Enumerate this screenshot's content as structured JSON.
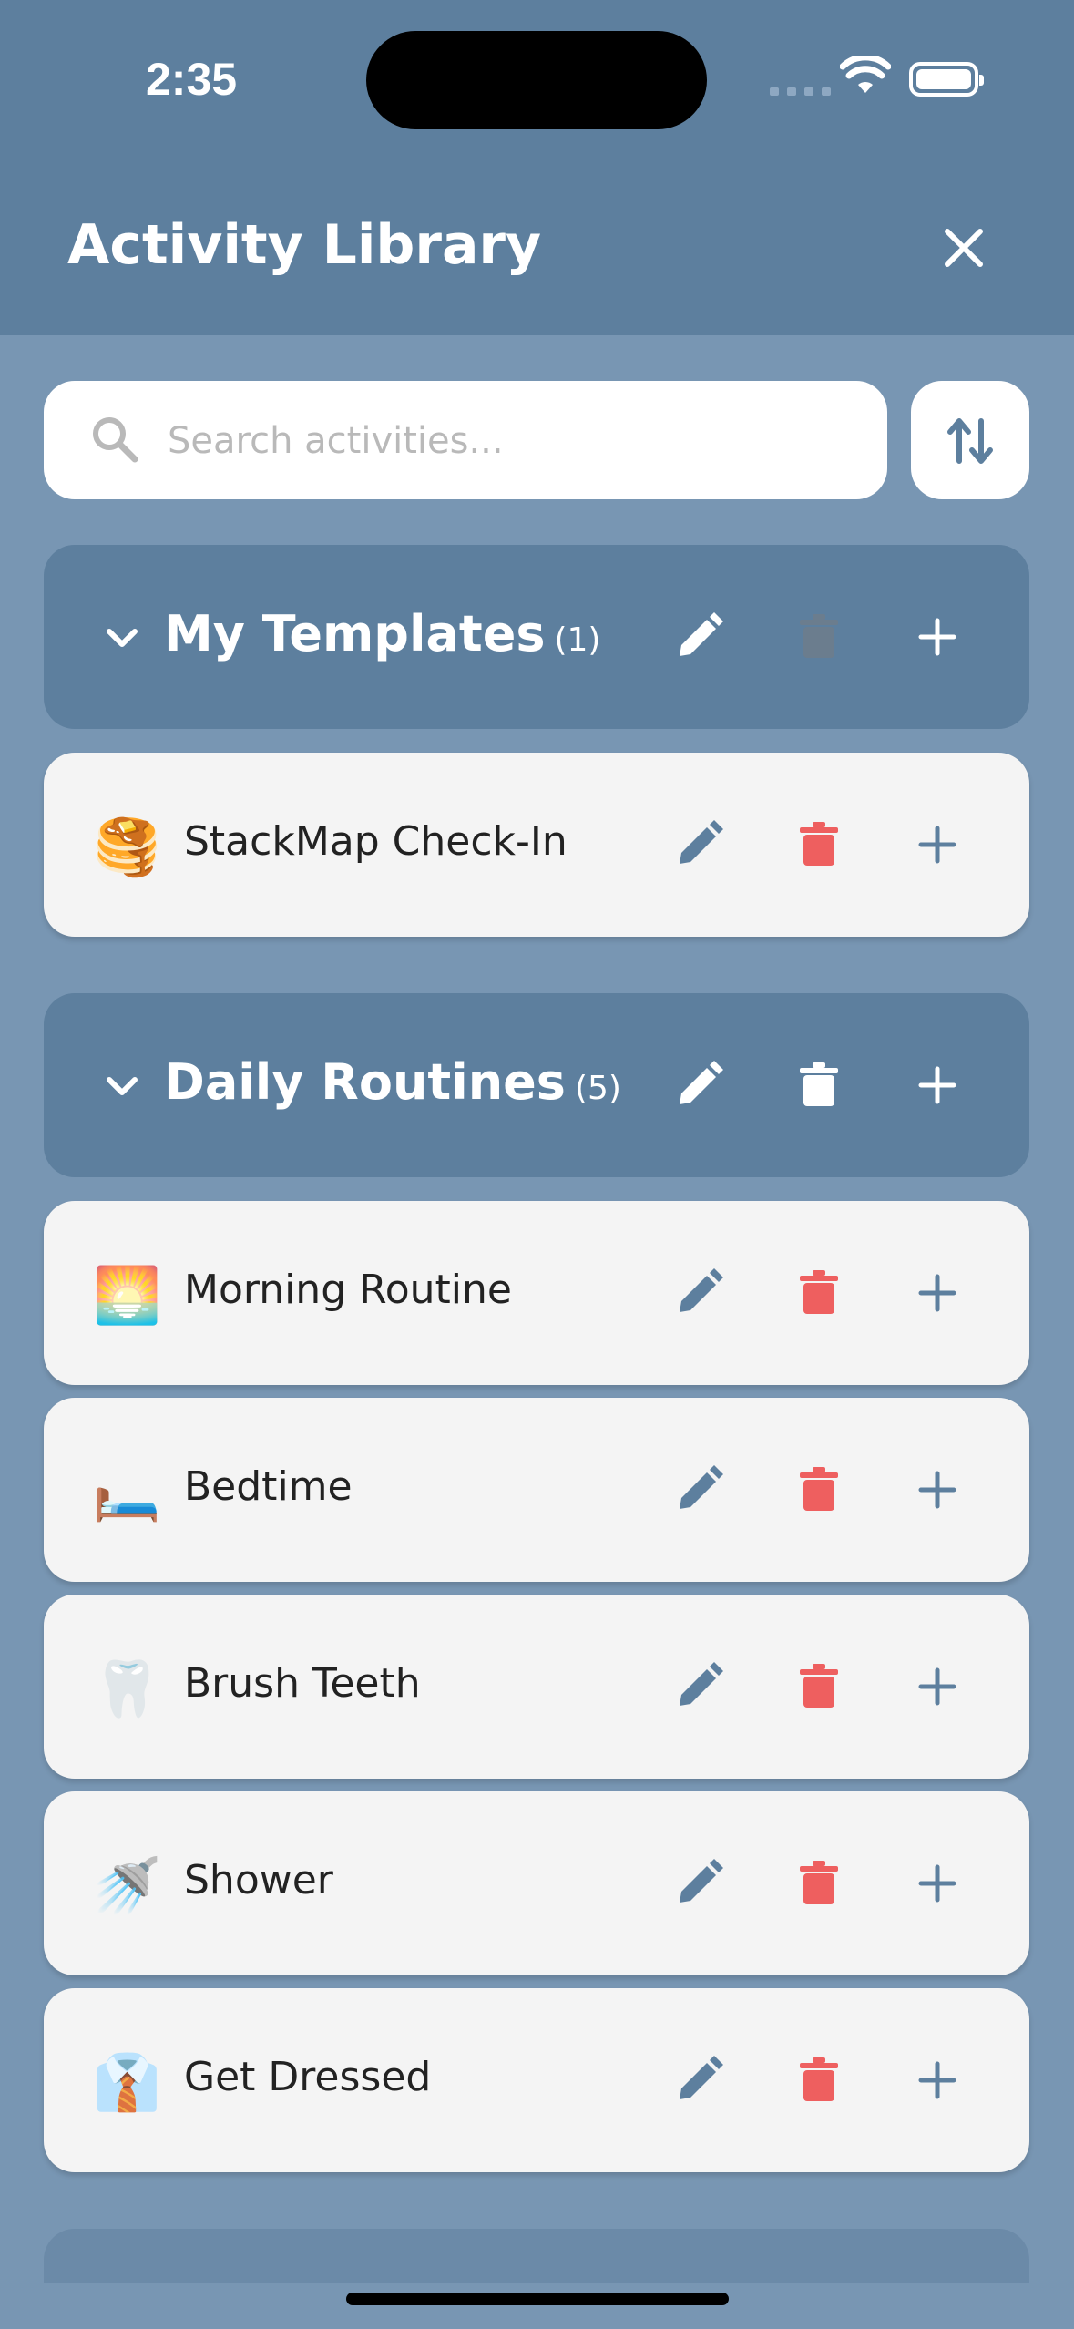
{
  "status": {
    "time": "2:35"
  },
  "header": {
    "title": "Activity Library"
  },
  "search": {
    "placeholder": "Search activities..."
  },
  "groups": [
    {
      "name": "My Templates",
      "count": "(1)",
      "items": [
        {
          "name": "StackMap Check-In",
          "emoji": "🥞"
        }
      ]
    },
    {
      "name": "Daily Routines",
      "count": "(5)",
      "items": [
        {
          "name": "Morning Routine",
          "emoji": "🌅"
        },
        {
          "name": "Bedtime",
          "emoji": "🛏️"
        },
        {
          "name": "Brush Teeth",
          "emoji": "🦷"
        },
        {
          "name": "Shower",
          "emoji": "🚿"
        },
        {
          "name": "Get Dressed",
          "emoji": "👔"
        }
      ]
    }
  ],
  "colors": {
    "header_bg": "#5d7f9e",
    "page_bg": "#7896b3",
    "row_bg": "#f4f4f4",
    "delete_red": "#ee5f5f",
    "icon_blue": "#5d7f9e"
  }
}
